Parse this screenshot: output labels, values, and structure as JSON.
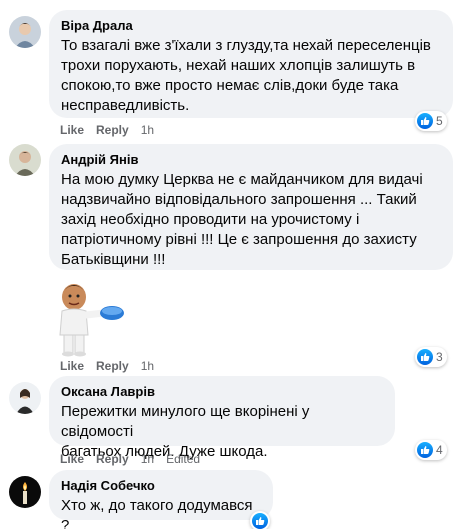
{
  "comments": [
    {
      "author": "Віра Драла",
      "text": "То взагалі вже з'їхали з глузду,та нехай переселенців\nтрохи порухають, нехай наших хлопців залишуть в\nспокою,то вже просто немає слів,доки буде така\nнесправедливість.",
      "like_label": "Like",
      "reply_label": "Reply",
      "time": "1h",
      "reaction_count": "5"
    },
    {
      "author": "Андрій Янів",
      "text": "На мою думку Церква не є майданчиком для видачі\nнадзвичайно відповідального запрошення ... Такий\nзахід необхідно проводити на урочистому і\nпатріотичному рівні !!! Це є запрошення до захисту\nБатьківщини !!!",
      "like_label": "Like",
      "reply_label": "Reply",
      "time": "1h",
      "reaction_count": "3"
    },
    {
      "author": "Оксана Лаврів",
      "text": "Пережитки минулого ще вкорінені у свідомості\nбагатьох людей. Дуже шкода.",
      "like_label": "Like",
      "reply_label": "Reply",
      "time": "1h",
      "edited": "Edited",
      "reaction_count": "4"
    },
    {
      "author": "Надія Собечко",
      "text": "Хто ж, до такого додумався ?"
    }
  ],
  "colors": {
    "bubble": "#f0f2f5",
    "meta_text": "#65676b",
    "like_blue": "#1877f2"
  },
  "icons": {
    "reaction": "like-thumb-icon",
    "sticker": "cartoon-man-sticker"
  }
}
